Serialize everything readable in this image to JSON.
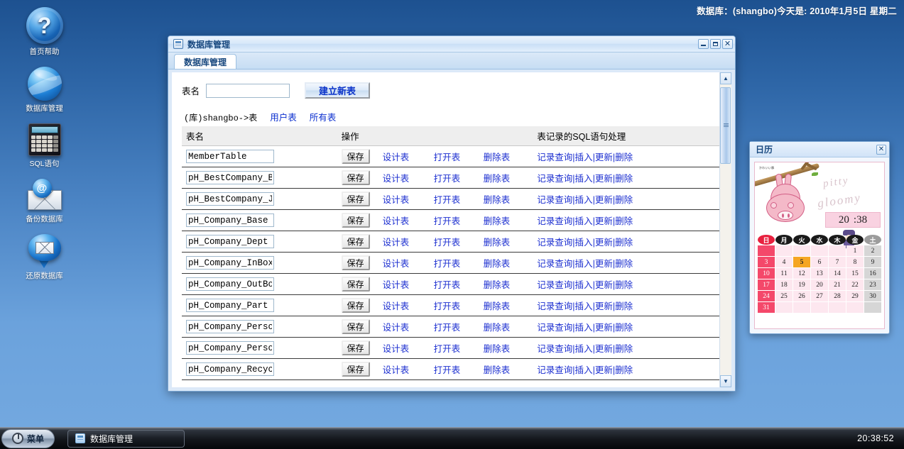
{
  "header": {
    "date_text": "数据库：(shangbo)今天是: 2010年1月5日 星期二"
  },
  "desktop": {
    "icons": [
      {
        "label": "首页帮助",
        "icon": "help-orb-icon"
      },
      {
        "label": "数据库管理",
        "icon": "globe-icon"
      },
      {
        "label": "SQL语句",
        "icon": "calculator-icon"
      },
      {
        "label": "备份数据库",
        "icon": "envelope-at-icon"
      },
      {
        "label": "还原数据库",
        "icon": "envelope-orb-icon"
      }
    ]
  },
  "window": {
    "title": "数据库管理",
    "tab_label": "数据库管理",
    "buttons": {
      "minimize": "–",
      "maximize": "❐",
      "close": "✕"
    },
    "form": {
      "label": "表名",
      "input_value": "",
      "input_placeholder": "",
      "create_button": "建立新表"
    },
    "breadcrumb": {
      "current": "(库)shangbo->表",
      "links": [
        "用户表",
        "所有表"
      ]
    },
    "table": {
      "headers": [
        "表名",
        "操作",
        "表记录的SQL语句处理"
      ],
      "ops": {
        "save": "保存",
        "design": "设计表",
        "open": "打开表",
        "delete": "删除表"
      },
      "sql_ops": [
        "记录查询",
        "插入",
        "更新",
        "删除"
      ],
      "separator": "|",
      "rows": [
        {
          "name": "MemberTable"
        },
        {
          "name": "pH_BestCompany_B"
        },
        {
          "name": "pH_BestCompany_J"
        },
        {
          "name": "pH_Company_Base"
        },
        {
          "name": "pH_Company_Dept"
        },
        {
          "name": "pH_Company_InBox"
        },
        {
          "name": "pH_Company_OutBo"
        },
        {
          "name": "pH_Company_Part"
        },
        {
          "name": "pH_Company_Perso"
        },
        {
          "name": "pH_Company_Perso"
        },
        {
          "name": "pH_Company_Recyc"
        }
      ]
    }
  },
  "calendar": {
    "title": "日历",
    "close_label": "✕",
    "art": {
      "brand": "かわいい豚",
      "text_line1": "pitty",
      "text_line2": "gloomy"
    },
    "clock": {
      "hour": "20",
      "minute": ":38"
    },
    "dow": [
      "日",
      "月",
      "火",
      "水",
      "木",
      "金",
      "土"
    ],
    "days": [
      "",
      "",
      "",
      "",
      "",
      "1",
      "2",
      "3",
      "4",
      "5",
      "6",
      "7",
      "8",
      "9",
      "10",
      "11",
      "12",
      "13",
      "14",
      "15",
      "16",
      "17",
      "18",
      "19",
      "20",
      "21",
      "22",
      "23",
      "24",
      "25",
      "26",
      "27",
      "28",
      "29",
      "30",
      "31",
      "",
      "",
      "",
      "",
      "",
      ""
    ],
    "today": "5"
  },
  "taskbar": {
    "start_label": "菜单",
    "tasks": [
      {
        "label": "数据库管理"
      }
    ],
    "clock": "20:38:52"
  }
}
